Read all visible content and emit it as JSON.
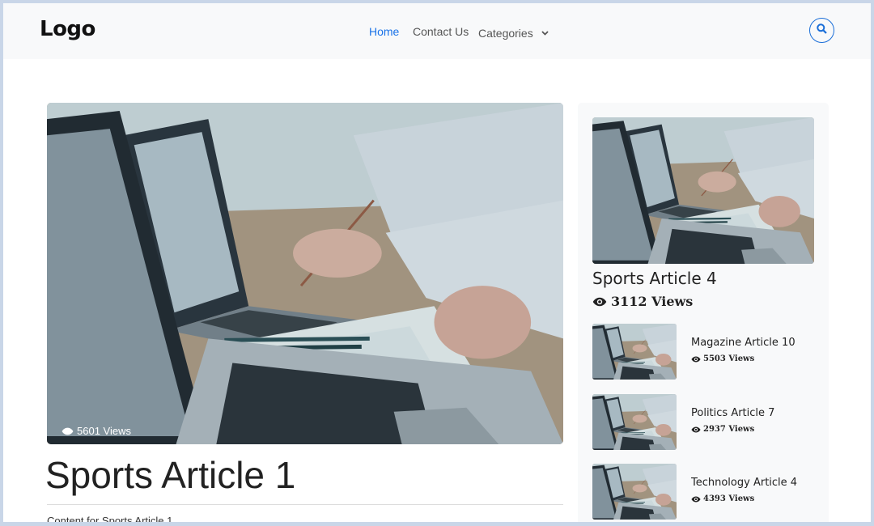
{
  "header": {
    "logo": "Logo",
    "nav": {
      "home": "Home",
      "contact": "Contact Us",
      "categories": "Categories"
    },
    "search_icon": "search-icon"
  },
  "colors": {
    "accent": "#1a73e8",
    "topbar": "#f8f9fa",
    "sidebar": "#f8f9fa"
  },
  "featured": {
    "views": "5601 Views",
    "title": "Sports Article 1",
    "content": "Content for Sports Article 1"
  },
  "sidebar": {
    "featured": {
      "title": "Sports Article 4",
      "views": "3112 Views"
    },
    "items": [
      {
        "title": "Magazine Article 10",
        "views": "5503 Views"
      },
      {
        "title": "Politics Article 7",
        "views": "2937 Views"
      },
      {
        "title": "Technology Article 4",
        "views": "4393 Views"
      }
    ]
  }
}
